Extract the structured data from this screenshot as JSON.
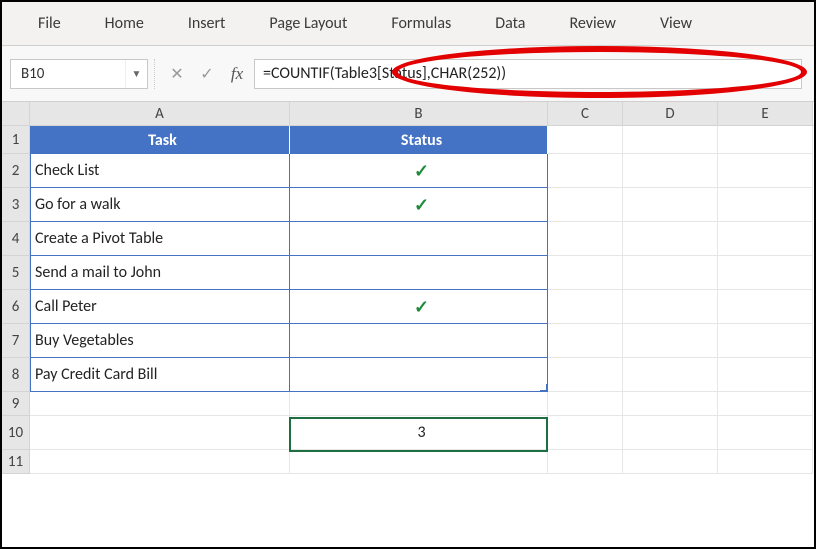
{
  "ribbon": [
    "File",
    "Home",
    "Insert",
    "Page Layout",
    "Formulas",
    "Data",
    "Review",
    "View"
  ],
  "name_box": "B10",
  "fx_label": "fx",
  "formula": "=COUNTIF(Table3[Status],CHAR(252))",
  "columns": [
    "A",
    "B",
    "C",
    "D",
    "E"
  ],
  "table": {
    "headers": [
      "Task",
      "Status"
    ],
    "rows": [
      {
        "task": "Check List",
        "status": true
      },
      {
        "task": "Go for a walk",
        "status": true
      },
      {
        "task": "Create a Pivot Table",
        "status": false
      },
      {
        "task": "Send a mail to John",
        "status": false
      },
      {
        "task": "Call Peter",
        "status": true
      },
      {
        "task": "Buy Vegetables",
        "status": false
      },
      {
        "task": "Pay Credit Card Bill",
        "status": false
      }
    ]
  },
  "result_label": "3",
  "checkmark_glyph": "✓",
  "row_headers": [
    "1",
    "2",
    "3",
    "4",
    "5",
    "6",
    "7",
    "8",
    "9",
    "10",
    "11"
  ]
}
